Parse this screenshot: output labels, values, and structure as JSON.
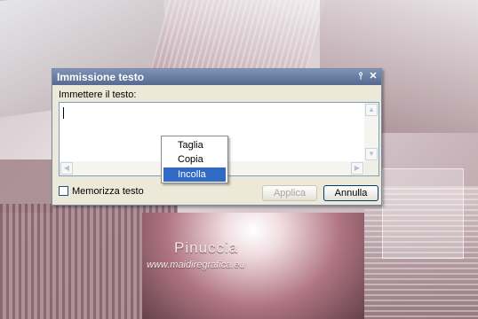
{
  "dialog": {
    "title": "Immissione testo",
    "pin_icon": "pin-icon",
    "close_icon": "close-icon",
    "prompt_label": "Immettere il testo:",
    "text_value": "",
    "checkbox": {
      "label": "Memorizza testo",
      "checked": false
    },
    "buttons": {
      "apply": "Applica",
      "cancel": "Annulla"
    }
  },
  "context_menu": {
    "items": [
      {
        "label": "Taglia",
        "highlighted": false
      },
      {
        "label": "Copia",
        "highlighted": false
      },
      {
        "label": "Incolla",
        "highlighted": true
      }
    ],
    "highlight_color": "#316ac5"
  },
  "watermark": {
    "name": "Pinuccia",
    "url": "www.maidiregrafica.eu"
  },
  "colors": {
    "titlebar": "#5f7599",
    "dialog_bg": "#ece9d8",
    "button_border": "#003c74"
  }
}
